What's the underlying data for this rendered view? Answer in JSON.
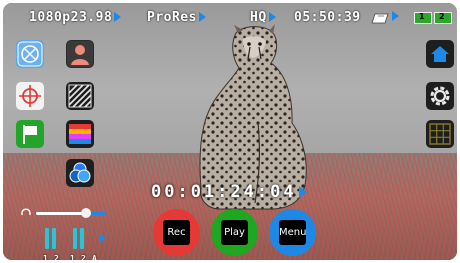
{
  "status_bar": {
    "format": "1080p23.98",
    "codec": "ProRes",
    "quality": "HQ",
    "remaining_time": "05:50:39",
    "battery_1_label": "1",
    "battery_2_label": "2"
  },
  "timecode": "00:01:24:04",
  "transport": {
    "rec_label": "Rec",
    "play_label": "Play",
    "menu_label": "Menu"
  },
  "audio": {
    "channel_labels": [
      "1",
      "2",
      "1",
      "2",
      "A"
    ],
    "headphone_volume_fraction": 0.72
  },
  "left_tools": [
    "focus-peaking-icon",
    "person-icon",
    "crosshair-icon",
    "zebra-icon",
    "flag-icon",
    "false-color-icon",
    "color-channels-icon"
  ],
  "right_tools": [
    "home-icon",
    "settings-icon",
    "grid-icon"
  ],
  "colors": {
    "accent_blue": "#1e88e5",
    "rec": "#e53935",
    "play": "#1fa81f",
    "menu": "#1e88e5"
  }
}
